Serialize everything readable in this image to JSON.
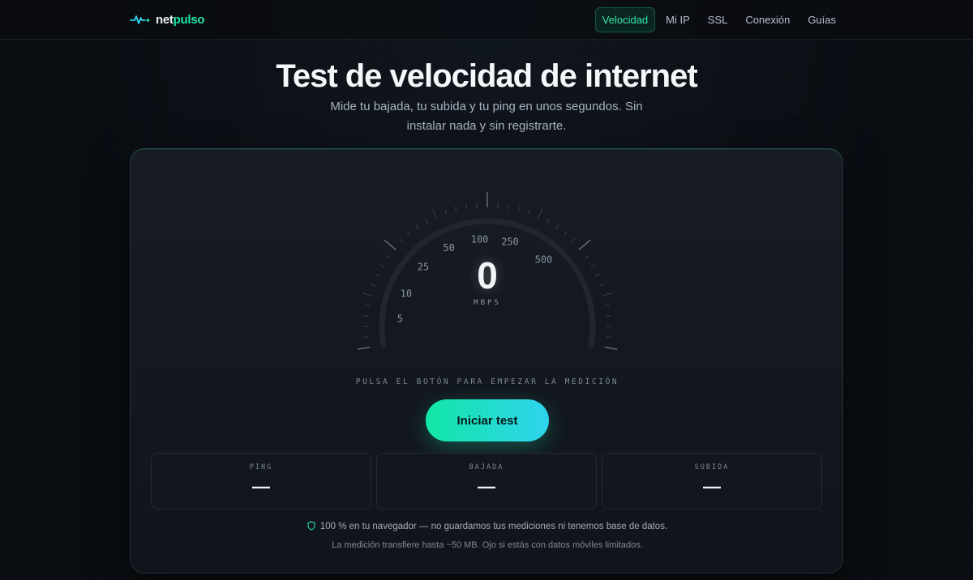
{
  "brand": {
    "name_part1": "net",
    "name_part2": "pulso",
    "logo_icon": "pulse-icon"
  },
  "nav": {
    "items": [
      {
        "label": "Velocidad",
        "active": true
      },
      {
        "label": "Mi IP",
        "active": false
      },
      {
        "label": "SSL",
        "active": false
      },
      {
        "label": "Conexión",
        "active": false
      },
      {
        "label": "Guías",
        "active": false
      }
    ]
  },
  "hero": {
    "title": "Test de velocidad de internet",
    "subtitle": "Mide tu bajada, tu subida y tu ping en unos segundos. Sin instalar nada y sin registrarte."
  },
  "gauge": {
    "value": "0",
    "unit": "MBPS",
    "scale_labels": [
      "5",
      "10",
      "25",
      "50",
      "100",
      "250",
      "500"
    ],
    "hint": "PULSA EL BOTÓN PARA EMPEZAR LA MEDICIÓN"
  },
  "start_button": {
    "label": "Iniciar test"
  },
  "stats": [
    {
      "label": "PING",
      "value": "—"
    },
    {
      "label": "BAJADA",
      "value": "—"
    },
    {
      "label": "SUBIDA",
      "value": "—"
    }
  ],
  "privacy": {
    "icon": "shield-icon",
    "text": "100 % en tu navegador — no guardamos tus mediciones ni tenemos base de datos."
  },
  "note": {
    "text": "La medición transfiere hasta ~50 MB. Ojo si estás con datos móviles limitados."
  },
  "colors": {
    "accent": "#1ee6a6",
    "accent2": "#2fd4ee",
    "background": "#0a0d12",
    "card": "#151920"
  }
}
